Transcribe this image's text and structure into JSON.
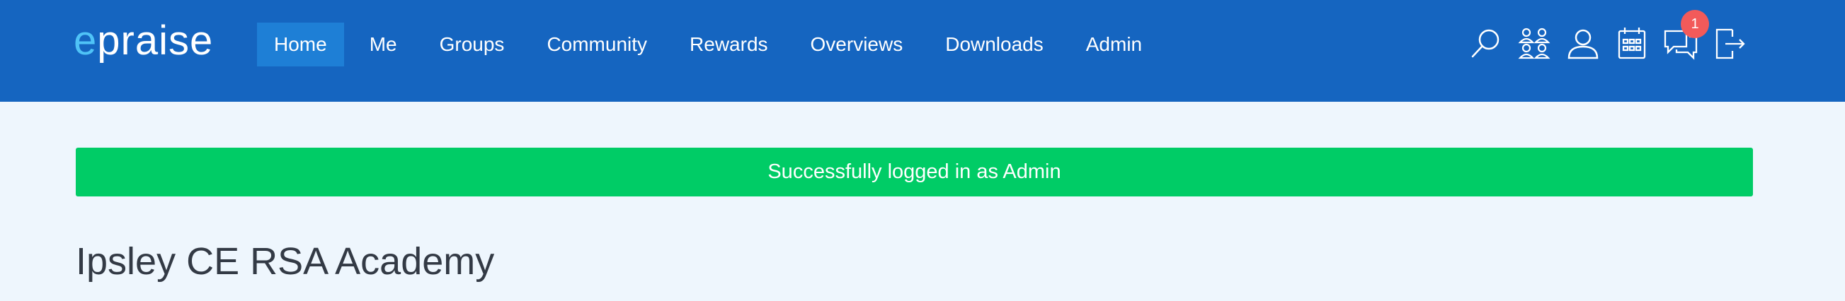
{
  "brand": {
    "logo_first": "e",
    "logo_rest": "praise",
    "accent_color": "#4fc3f7",
    "bar_color": "#1565c0"
  },
  "nav": {
    "items": [
      {
        "label": "Home",
        "active": true
      },
      {
        "label": "Me"
      },
      {
        "label": "Groups"
      },
      {
        "label": "Community"
      },
      {
        "label": "Rewards"
      },
      {
        "label": "Overviews"
      },
      {
        "label": "Downloads"
      },
      {
        "label": "Admin"
      }
    ]
  },
  "toolbar": {
    "icons": [
      "search-icon",
      "groups-icon",
      "user-icon",
      "calendar-icon",
      "messages-icon",
      "logout-icon"
    ],
    "message_count": "1",
    "badge_color": "#f25a5a"
  },
  "alert": {
    "text": "Successfully logged in as Admin",
    "color": "#00cc66"
  },
  "page": {
    "title": "Ipsley CE RSA Academy"
  }
}
